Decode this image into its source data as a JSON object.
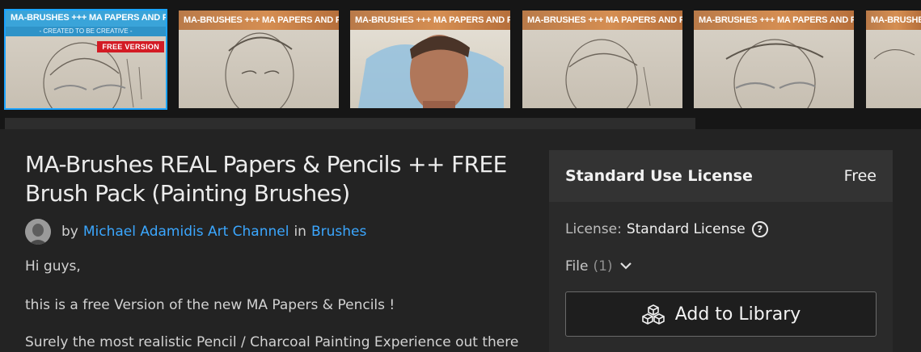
{
  "thumbnails": [
    {
      "banner": "MA-BRUSHES +++ MA PAPERS AND PENCILS",
      "subtitle": "- CREATED TO BE CREATIVE -",
      "tag": "FREE VERSION",
      "active": true
    },
    {
      "banner": "MA-BRUSHES +++ MA PAPERS AND PENCILS"
    },
    {
      "banner": "MA-BRUSHES +++ MA PAPERS AND PENCILS"
    },
    {
      "banner": "MA-BRUSHES +++ MA PAPERS AND PENCILS"
    },
    {
      "banner": "MA-BRUSHES +++ MA PAPERS AND PENCILS"
    },
    {
      "banner": "MA-BRUSHES +++ MA PAPERS AND PENCILS"
    }
  ],
  "product": {
    "title": "MA-Brushes REAL Papers & Pencils ++ FREE Brush Pack (Painting Brushes)",
    "by_label": "by",
    "author": "Michael Adamidis Art Channel",
    "in_label": "in",
    "category": "Brushes"
  },
  "description": [
    "Hi guys,",
    "this is a free Version of the new MA Papers & Pencils !",
    "Surely the most realistic Pencil / Charcoal Painting Experience out there"
  ],
  "license_panel": {
    "name": "Standard Use License",
    "price": "Free",
    "license_label": "License:",
    "license_value": "Standard License",
    "file_label": "File",
    "file_count": "(1)",
    "add_button": "Add to Library"
  },
  "colors": {
    "accent": "#3ba7ff",
    "active_outline": "#1aa3ff",
    "background": "#232323",
    "panel": "#2a2a2a"
  }
}
